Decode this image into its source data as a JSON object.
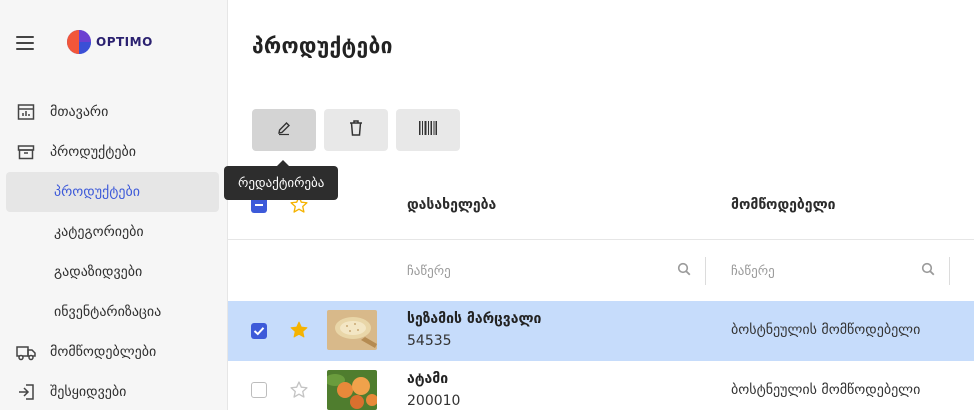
{
  "app": {
    "logo_text": "OPTIMO"
  },
  "sidebar": {
    "items": [
      {
        "label": "მთავარი",
        "icon": "dashboard-icon"
      },
      {
        "label": "პროდუქტები",
        "icon": "archive-box-icon"
      },
      {
        "label": "პროდუქტები",
        "sub": true,
        "active": true
      },
      {
        "label": "კატეგორიები",
        "sub": true
      },
      {
        "label": "გადაზიდვები",
        "sub": true
      },
      {
        "label": "ინვენტარიზაცია",
        "sub": true
      },
      {
        "label": "მომწოდებლები",
        "icon": "truck-icon"
      },
      {
        "label": "შესყიდვები",
        "icon": "import-icon"
      }
    ]
  },
  "main": {
    "title": "პროდუქტები",
    "toolbar": {
      "edit_tooltip": "რედაქტირება"
    }
  },
  "table": {
    "columns": {
      "name": "დასახელება",
      "supplier": "მომწოდებელი"
    },
    "filters": {
      "name_placeholder": "ჩაწერე",
      "supplier_placeholder": "ჩაწერე"
    },
    "rows": [
      {
        "name": "სეზამის მარცვალი",
        "code": "54535",
        "supplier": "ბოსტნეულის მომწოდებელი",
        "selected": true,
        "favorite": true
      },
      {
        "name": "ატამი",
        "code": "200010",
        "supplier": "ბოსტნეულის მომწოდებელი",
        "selected": false,
        "favorite": false
      }
    ]
  },
  "colors": {
    "accent": "#3d5ad9",
    "selected_row": "#c6dcfb",
    "star": "#f5b301"
  }
}
